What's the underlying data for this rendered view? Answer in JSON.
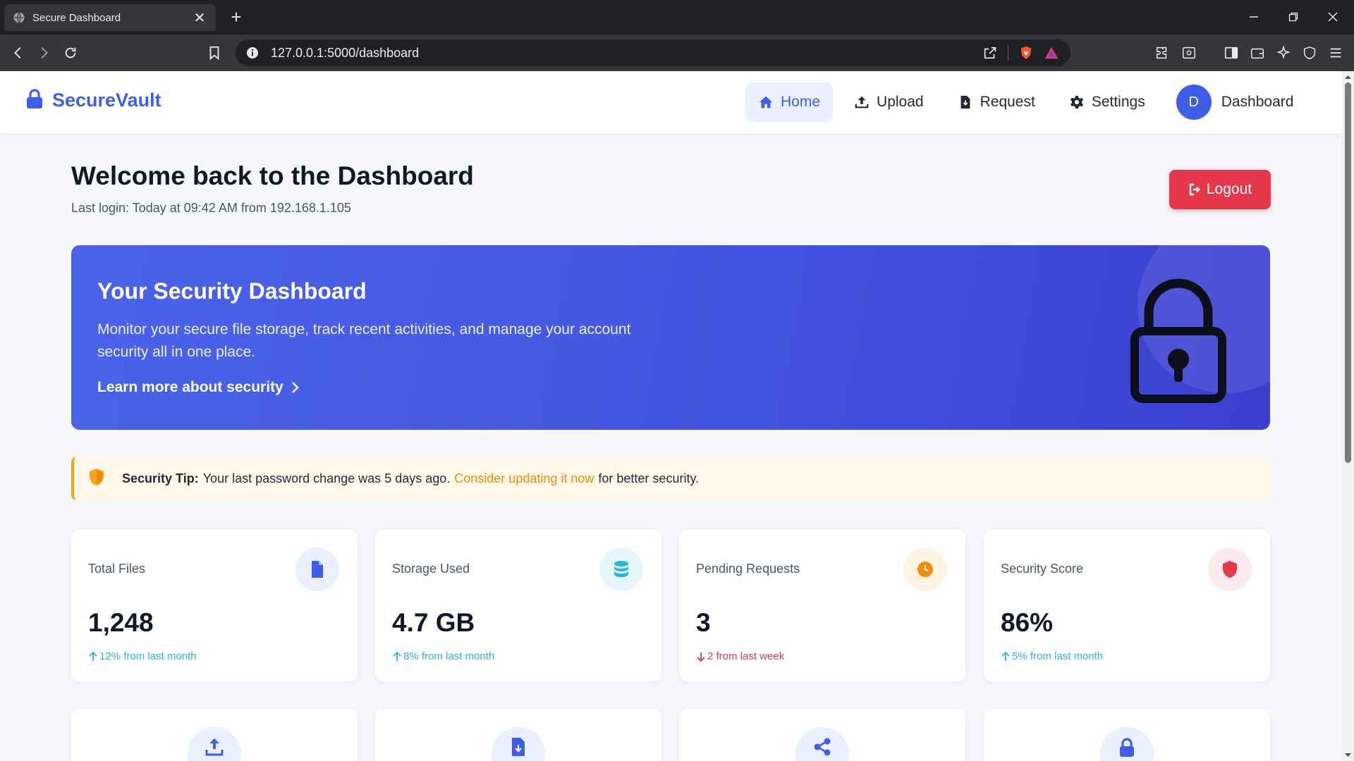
{
  "browser": {
    "tab_title": "Secure Dashboard",
    "url": "127.0.0.1:5000/dashboard"
  },
  "navbar": {
    "brand": "SecureVault",
    "items": [
      {
        "label": "Home",
        "icon": "home-icon",
        "active": true
      },
      {
        "label": "Upload",
        "icon": "upload-icon",
        "active": false
      },
      {
        "label": "Request",
        "icon": "file-download-icon",
        "active": false
      },
      {
        "label": "Settings",
        "icon": "gear-icon",
        "active": false
      }
    ],
    "user_initial": "D",
    "user_label": "Dashboard"
  },
  "header": {
    "title": "Welcome back to the Dashboard",
    "last_login": "Last login: Today at 09:42 AM from 192.168.1.105",
    "logout_label": "Logout"
  },
  "hero": {
    "title": "Your Security Dashboard",
    "description": "Monitor your secure file storage, track recent activities, and manage your account security all in one place.",
    "link_label": "Learn more about security"
  },
  "tip": {
    "label": "Security Tip:",
    "text_before": "Your last password change was 5 days ago.",
    "link": "Consider updating it now",
    "text_after": "for better security."
  },
  "stats": [
    {
      "title": "Total Files",
      "value": "1,248",
      "change": "12% from last month",
      "trend": "up",
      "icon": "file-icon",
      "icon_color": "#3f5ee8",
      "icon_bg": "#eaf0ff"
    },
    {
      "title": "Storage Used",
      "value": "4.7 GB",
      "change": "8% from last month",
      "trend": "up",
      "icon": "database-icon",
      "icon_color": "#2bb4dd",
      "icon_bg": "#e6f7fc"
    },
    {
      "title": "Pending Requests",
      "value": "3",
      "change": "2 from last week",
      "trend": "down",
      "icon": "clock-icon",
      "icon_color": "#f08c0a",
      "icon_bg": "#fff3e2"
    },
    {
      "title": "Security Score",
      "value": "86%",
      "change": "5% from last month",
      "trend": "up",
      "icon": "shield-icon",
      "icon_color": "#e5384a",
      "icon_bg": "#fdeaec"
    }
  ],
  "actions": [
    {
      "icon": "upload-icon"
    },
    {
      "icon": "file-download-icon"
    },
    {
      "icon": "share-icon"
    },
    {
      "icon": "lock-icon"
    }
  ],
  "colors": {
    "accent": "#3f5ee8",
    "danger": "#e5384a",
    "warning": "#f08c0a",
    "info": "#2bb4dd"
  }
}
